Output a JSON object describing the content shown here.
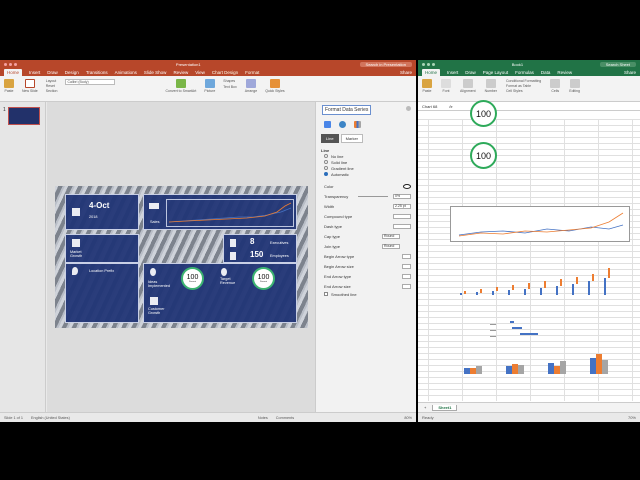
{
  "ppt": {
    "title": "Presentation1",
    "search_placeholder": "Search in Presentation",
    "tabs": [
      "Home",
      "Insert",
      "Draw",
      "Design",
      "Transitions",
      "Animations",
      "Slide Show",
      "Review",
      "View",
      "Chart Design",
      "Format"
    ],
    "share_label": "Share",
    "ribbon": {
      "paste": "Paste",
      "new_slide": "New Slide",
      "layout": "Layout",
      "reset": "Reset",
      "section": "Section",
      "font_name": "Calibri (Body)",
      "convert_smartart": "Convert to SmartArt",
      "picture": "Picture",
      "shapes": "Shapes",
      "text_box": "Text Box",
      "arrange": "Arrange",
      "quick_styles": "Quick Styles"
    },
    "slide_number": "1",
    "slide": {
      "date": "4-Oct",
      "year": "2018",
      "sales_label": "Sales",
      "market_growth": "Market Growth",
      "location_label": "Location Prefix",
      "executives_value": "8",
      "executives_label": "Executives",
      "employees_value": "150",
      "employees_label": "Employees",
      "ideas_label": "Ideas Implemented",
      "customer_label": "Customer Growth",
      "target_label": "Target Revenue",
      "circle1_value": "100",
      "circle1_sub": "Percent",
      "circle2_value": "100",
      "circle2_sub": "Percent"
    },
    "format_pane": {
      "title": "Format Data Series",
      "tabs": [
        "Line",
        "Marker"
      ],
      "section": "Line",
      "options": [
        "No line",
        "Solid line",
        "Gradient line",
        "Automatic"
      ],
      "selected_option": "Automatic",
      "props": [
        {
          "label": "Color",
          "value": ""
        },
        {
          "label": "Transparency",
          "value": "0%"
        },
        {
          "label": "Width",
          "value": "2.25 pt"
        },
        {
          "label": "Compound type",
          "value": ""
        },
        {
          "label": "Dash type",
          "value": ""
        },
        {
          "label": "Cap type",
          "value": "Round"
        },
        {
          "label": "Join type",
          "value": "Round"
        },
        {
          "label": "Begin Arrow type",
          "value": ""
        },
        {
          "label": "Begin Arrow size",
          "value": ""
        },
        {
          "label": "End Arrow type",
          "value": ""
        },
        {
          "label": "End Arrow size",
          "value": ""
        }
      ],
      "smoothed": "Smoothed line"
    },
    "status": {
      "slide_info": "Slide 1 of 1",
      "language": "English (United States)",
      "notes": "Notes",
      "comments": "Comments",
      "zoom": "80%"
    }
  },
  "excel": {
    "title": "Book1",
    "search_placeholder": "Search Sheet",
    "tabs": [
      "Home",
      "Insert",
      "Draw",
      "Page Layout",
      "Formulas",
      "Data",
      "Review"
    ],
    "share_label": "Share",
    "ribbon": {
      "paste": "Paste",
      "font": "Font",
      "alignment": "Alignment",
      "number": "Number",
      "conditional_formatting": "Conditional Formatting",
      "format_as_table": "Format as Table",
      "cell_styles": "Cell Styles",
      "cells": "Cells",
      "editing": "Editing"
    },
    "name_box": "Chart 68",
    "circle_top": "100",
    "circle_bottom": "100",
    "sheet_tab": "Sheet1",
    "status_ready": "Ready",
    "zoom": "70%"
  },
  "colors": {
    "ppt_accent": "#b7472a",
    "excel_accent": "#217346",
    "slide_panel": "#213576",
    "circle_ring": "#3cb371",
    "series_blue": "#4472c4",
    "series_orange": "#ed7d31"
  }
}
